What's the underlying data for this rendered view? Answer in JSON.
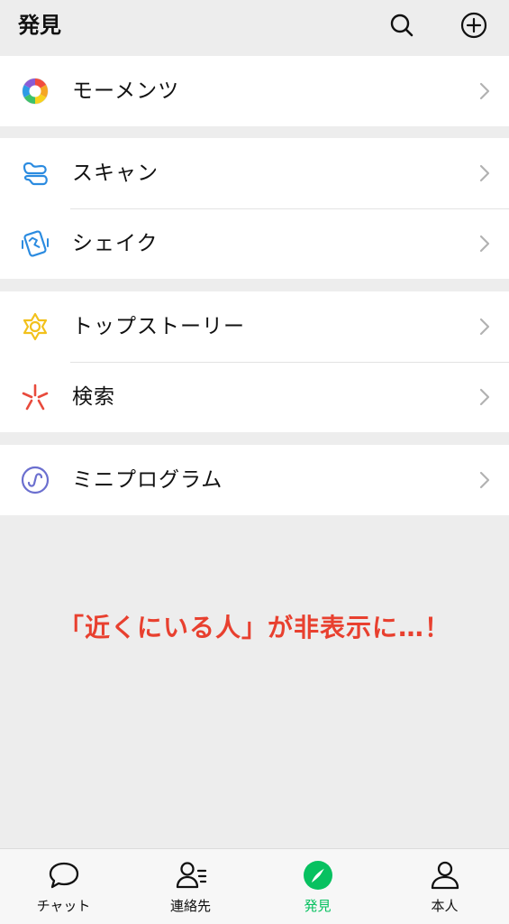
{
  "header": {
    "title": "発見"
  },
  "menu": {
    "moments": "モーメンツ",
    "scan": "スキャン",
    "shake": "シェイク",
    "top_stories": "トップストーリー",
    "search": "検索",
    "mini_programs": "ミニプログラム"
  },
  "notice": "「近くにいる人」が非表示に…！",
  "tabs": {
    "chats": "チャット",
    "contacts": "連絡先",
    "discover": "発見",
    "me": "本人"
  },
  "colors": {
    "accent_green": "#07c160",
    "notice_red": "#e8402f",
    "scan_blue": "#2b8be0",
    "topstories_yellow": "#f2c11c",
    "search_red": "#e84a3c",
    "mini_purple": "#6b6fcf"
  },
  "icons": {
    "moments": "moments-aperture-icon",
    "scan": "scan-icon",
    "shake": "shake-icon",
    "top_stories": "top-stories-icon",
    "search": "search-sparkle-icon",
    "mini_programs": "mini-programs-icon"
  }
}
